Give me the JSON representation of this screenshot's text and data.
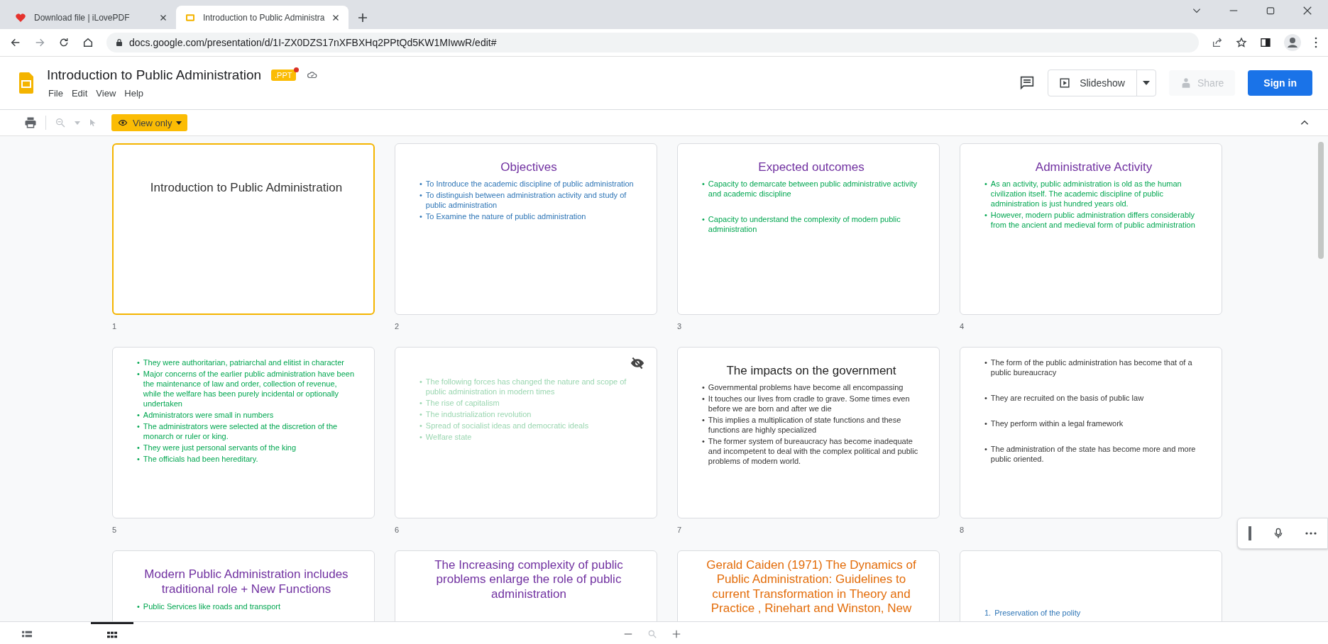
{
  "browser": {
    "tabs": [
      {
        "kind": "heart",
        "title": "Download file | iLovePDF",
        "selected": false
      },
      {
        "kind": "slides",
        "title": "Introduction to Public Administra",
        "selected": true
      }
    ],
    "url": "docs.google.com/presentation/d/1I-ZX0DZS17nXFBXHq2PPtQd5KW1MIwwR/edit#"
  },
  "app": {
    "title": "Introduction to Public Administration",
    "badge": ".PPT",
    "menu": [
      "File",
      "Edit",
      "View",
      "Help"
    ],
    "slideshow": "Slideshow",
    "share": {
      "label": "Share",
      "disabled": true
    },
    "sign_in": "Sign in",
    "view_mode": "View only"
  },
  "slides": [
    {
      "number": "1",
      "selected": true,
      "hidden": false,
      "cover": true,
      "title": {
        "text": "Introduction to Public Administration",
        "color": "#333333"
      }
    },
    {
      "number": "2",
      "selected": false,
      "hidden": false,
      "title": {
        "text": "Objectives",
        "color": "#7030a0"
      },
      "body": {
        "color": "#2e75b6",
        "items": [
          {
            "marker": "•",
            "text": "To Introduce the academic discipline of public administration"
          },
          {
            "marker": "•",
            "text": "To distinguish between administration activity and study of public administration"
          },
          {
            "marker": "•",
            "text": "To Examine the nature of public administration"
          }
        ]
      }
    },
    {
      "number": "3",
      "selected": false,
      "hidden": false,
      "title": {
        "text": "Expected outcomes",
        "color": "#7030a0"
      },
      "body": {
        "color": "#00a650",
        "wide": true,
        "items": [
          {
            "marker": "•",
            "text": "Capacity to demarcate between public administrative activity and academic discipline"
          },
          {
            "marker": "•",
            "text": "Capacity to understand the complexity of modern public administration"
          }
        ]
      }
    },
    {
      "number": "4",
      "selected": false,
      "hidden": false,
      "title": {
        "text": "Administrative Activity",
        "color": "#7030a0"
      },
      "body": {
        "color": "#00a650",
        "items": [
          {
            "marker": "•",
            "text": "As an activity, public administration is old as the human civilization itself.  The academic discipline of public administration is just hundred years  old."
          },
          {
            "marker": "•",
            "text": "However, modern public administration differs considerably from the ancient and medieval form of public administration"
          }
        ]
      }
    },
    {
      "number": "5",
      "selected": false,
      "hidden": false,
      "body": {
        "color": "#00a650",
        "items": [
          {
            "marker": "•",
            "text": "They were authoritarian, patriarchal and elitist in character"
          },
          {
            "marker": "•",
            "text": "Major concerns of the earlier public administration have been the maintenance of law and order, collection of revenue, while the welfare has been purely incidental or optionally undertaken"
          },
          {
            "marker": "•",
            "text": "Administrators were small in numbers"
          },
          {
            "marker": "•",
            "text": "The administrators were selected at the discretion of the monarch or ruler or king."
          },
          {
            "marker": "•",
            "text": "They were just personal servants of the king"
          },
          {
            "marker": "•",
            "text": "The officials had been hereditary."
          }
        ]
      }
    },
    {
      "number": "6",
      "selected": false,
      "hidden": true,
      "body": {
        "color": "#9ad6b0",
        "items": [
          {
            "marker": "•",
            "text": "The following forces has changed the nature and scope of public administration in modern times"
          },
          {
            "marker": "•",
            "text": "The rise of capitalism"
          },
          {
            "marker": "•",
            "text": "The industrialization revolution"
          },
          {
            "marker": "•",
            "text": "Spread of socialist ideas  and democratic ideals"
          },
          {
            "marker": "•",
            "text": "Welfare state"
          }
        ]
      }
    },
    {
      "number": "7",
      "selected": false,
      "hidden": false,
      "title": {
        "text": "The impacts on the government",
        "color": "#222222"
      },
      "body": {
        "color": "#333333",
        "items": [
          {
            "marker": "•",
            "text": "Governmental problems have become all encompassing"
          },
          {
            "marker": "•",
            "text": "It touches our lives from cradle to grave. Some times even before we are born and after we die"
          },
          {
            "marker": "•",
            "text": "This implies a multiplication of  state functions and these functions are  highly specialized"
          },
          {
            "marker": "•",
            "text": "The former system of bureaucracy has become inadequate and incompetent to deal with the complex political and public problems of  modern world."
          }
        ]
      }
    },
    {
      "number": "8",
      "selected": false,
      "hidden": false,
      "body": {
        "color": "#333333",
        "wide": true,
        "items": [
          {
            "marker": "•",
            "text": "The form of the public administration has become  that of a public bureaucracy"
          },
          {
            "marker": "•",
            "text": "They are recruited on the basis of public law"
          },
          {
            "marker": "•",
            "text": "They perform within a legal framework"
          },
          {
            "marker": "•",
            "text": "The administration of the state has become more and more public oriented."
          }
        ]
      }
    },
    {
      "selected": false,
      "hidden": false,
      "title": {
        "text": "Modern Public Administration includes traditional role + New Functions",
        "color": "#7030a0"
      },
      "body": {
        "color": "#00a650",
        "items": [
          {
            "marker": "•",
            "text": "Public Services like roads and transport"
          }
        ]
      }
    },
    {
      "selected": false,
      "hidden": false,
      "title": {
        "text": "The Increasing complexity of public problems enlarge the role of public administration",
        "color": "#7030a0"
      }
    },
    {
      "selected": false,
      "hidden": false,
      "title": {
        "text": "Gerald  Caiden (1971) The Dynamics of Public Administration: Guidelines to current Transformation in Theory and Practice , Rinehart and Winston, New",
        "color": "#e36c09"
      }
    },
    {
      "selected": false,
      "hidden": false,
      "body": {
        "color": "#2e75b6",
        "items": [
          {
            "marker": "1.",
            "text": "Preservation of the polity"
          }
        ]
      }
    }
  ],
  "bottom": {
    "views": [
      {
        "kind": "list",
        "selected": false
      },
      {
        "kind": "grid",
        "selected": true
      }
    ]
  }
}
